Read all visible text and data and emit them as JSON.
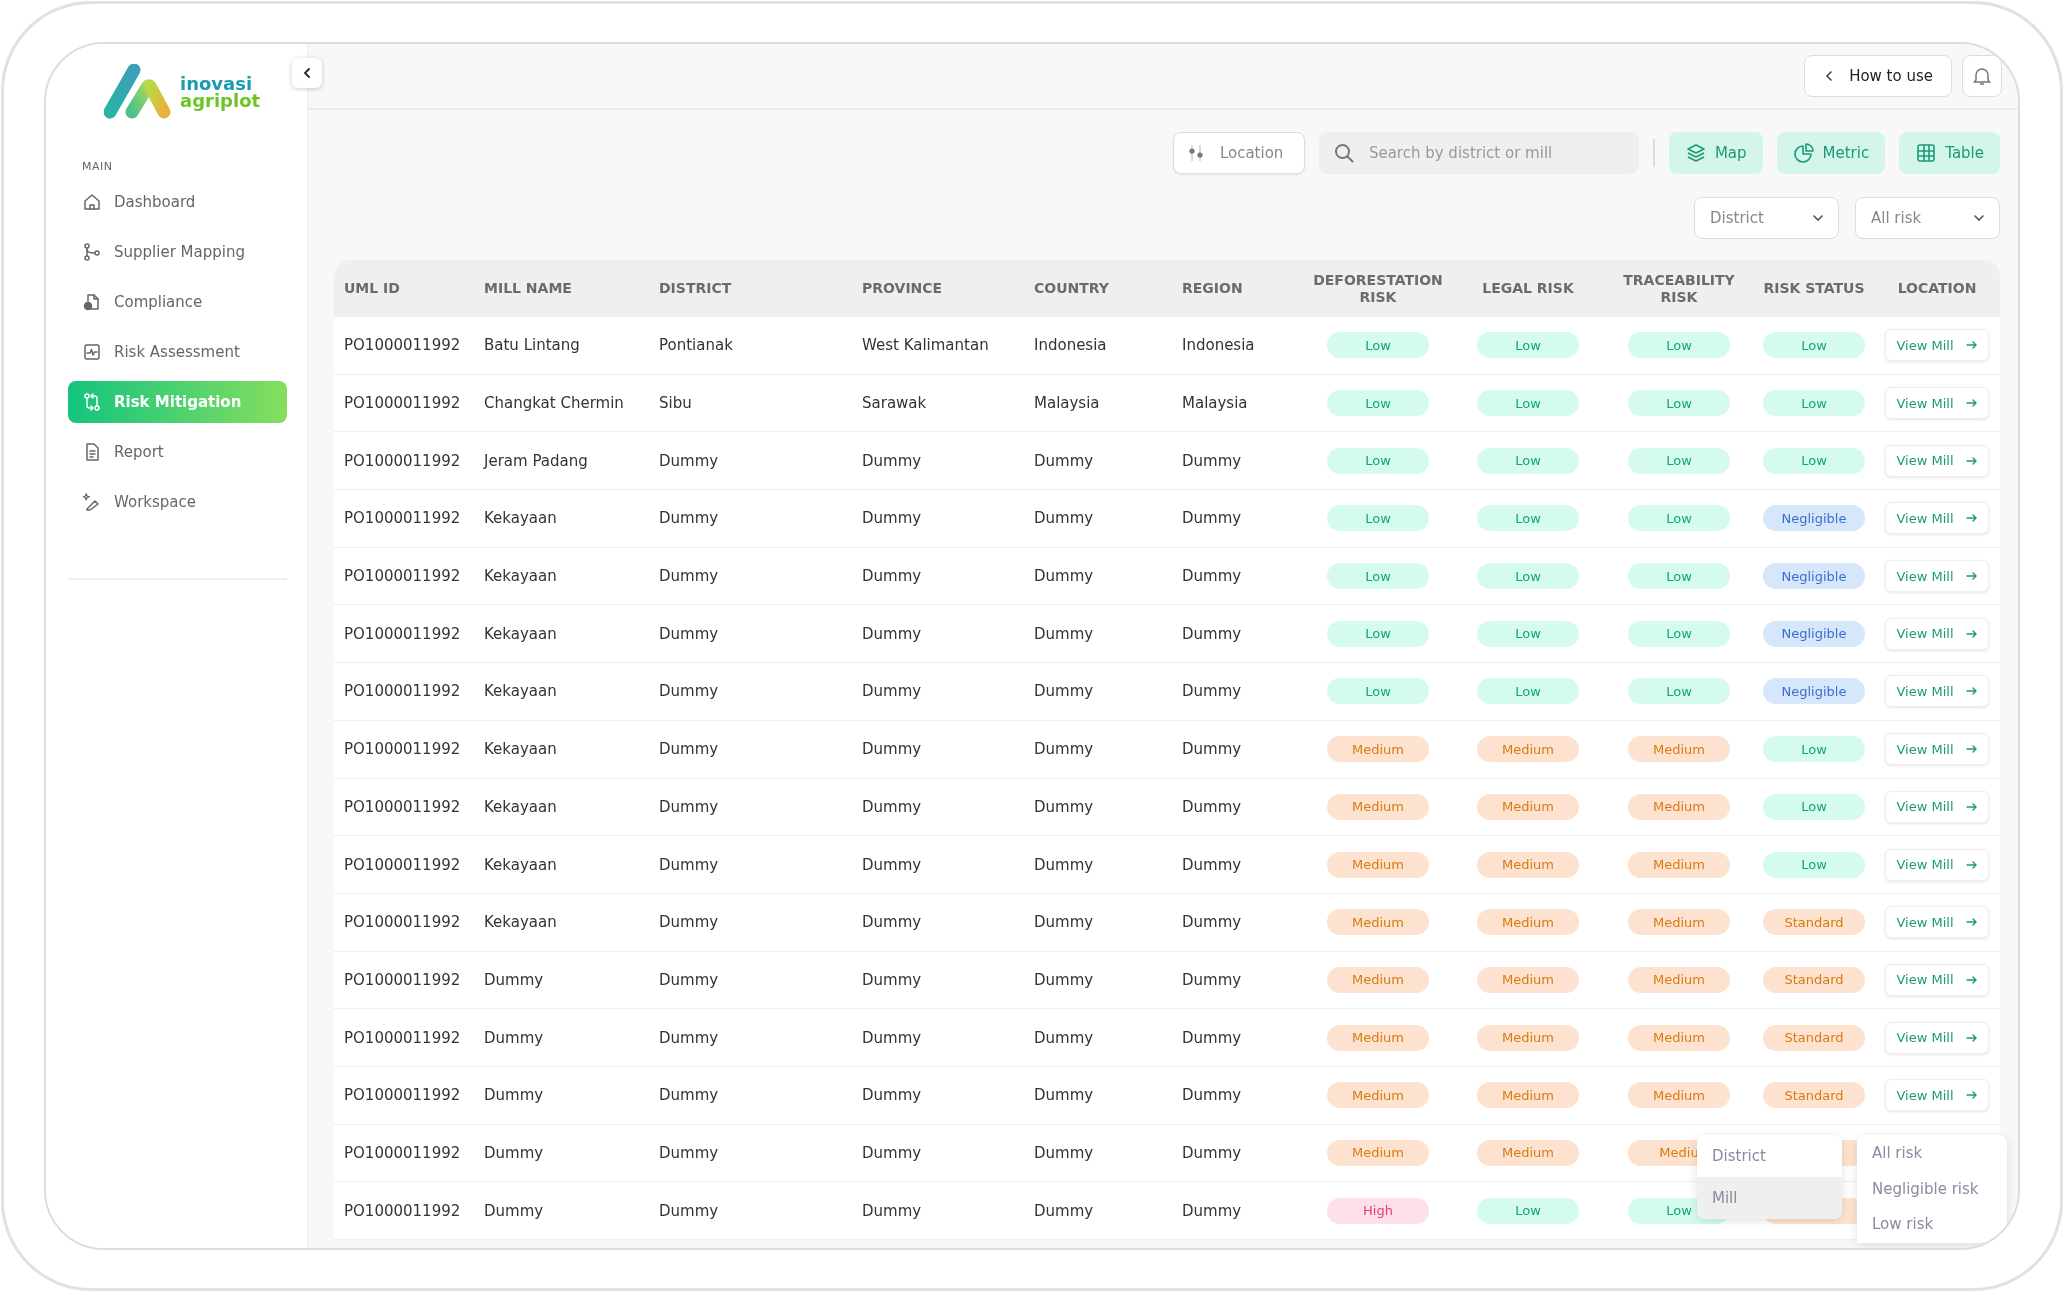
{
  "logo": {
    "line_1": "inovasi",
    "line_2": "agriplot"
  },
  "sidebar": {
    "section": "MAIN",
    "items": [
      {
        "label": "Dashboard",
        "selected": false
      },
      {
        "label": "Supplier Mapping",
        "selected": false
      },
      {
        "label": "Compliance",
        "selected": false
      },
      {
        "label": "Risk Assessment",
        "selected": false
      },
      {
        "label": "Risk Mitigation",
        "selected": true
      },
      {
        "label": "Report",
        "selected": false
      },
      {
        "label": "Workspace",
        "selected": false
      }
    ]
  },
  "topbar": {
    "help_button": "How to use"
  },
  "toolbar": {
    "location_button": "Location",
    "search": {
      "placeholder": "Search by district or mill"
    },
    "view_buttons": [
      {
        "label": "Map"
      },
      {
        "label": "Metric"
      },
      {
        "label": "Table"
      }
    ],
    "filters": [
      {
        "value": "District"
      },
      {
        "value": "All risk"
      }
    ]
  },
  "table": {
    "columns": [
      "UML ID",
      "MILL NAME",
      "DISTRICT",
      "PROVINCE",
      "COUNTRY",
      "REGION",
      "DEFORESTATION RISK",
      "LEGAL RISK",
      "TRACEABILITY RISK",
      "RISK STATUS",
      "LOCATION"
    ],
    "rows": [
      {
        "uml_id": "PO1000011992",
        "mill": "Batu Lintang",
        "district": "Pontianak",
        "province": "West Kalimantan",
        "country": "Indonesia",
        "region": "Indonesia",
        "risks": [
          {
            "label": "Low",
            "kind": "low"
          },
          {
            "label": "Low",
            "kind": "low"
          },
          {
            "label": "Low",
            "kind": "low"
          },
          {
            "label": "Low",
            "kind": "low"
          }
        ],
        "location": "View Mill"
      },
      {
        "uml_id": "PO1000011992",
        "mill": "Changkat Chermin",
        "district": "Sibu",
        "province": "Sarawak",
        "country": "Malaysia",
        "region": "Malaysia",
        "risks": [
          {
            "label": "Low",
            "kind": "low"
          },
          {
            "label": "Low",
            "kind": "low"
          },
          {
            "label": "Low",
            "kind": "low"
          },
          {
            "label": "Low",
            "kind": "low"
          }
        ],
        "location": "View Mill"
      },
      {
        "uml_id": "PO1000011992",
        "mill": "Jeram Padang",
        "district": "Dummy",
        "province": "Dummy",
        "country": "Dummy",
        "region": "Dummy",
        "risks": [
          {
            "label": "Low",
            "kind": "low"
          },
          {
            "label": "Low",
            "kind": "low"
          },
          {
            "label": "Low",
            "kind": "low"
          },
          {
            "label": "Low",
            "kind": "low"
          }
        ],
        "location": "View Mill"
      },
      {
        "uml_id": "PO1000011992",
        "mill": "Kekayaan",
        "district": "Dummy",
        "province": "Dummy",
        "country": "Dummy",
        "region": "Dummy",
        "risks": [
          {
            "label": "Low",
            "kind": "low"
          },
          {
            "label": "Low",
            "kind": "low"
          },
          {
            "label": "Low",
            "kind": "low"
          },
          {
            "label": "Negligible",
            "kind": "negligible"
          }
        ],
        "location": "View Mill"
      },
      {
        "uml_id": "PO1000011992",
        "mill": "Kekayaan",
        "district": "Dummy",
        "province": "Dummy",
        "country": "Dummy",
        "region": "Dummy",
        "risks": [
          {
            "label": "Low",
            "kind": "low"
          },
          {
            "label": "Low",
            "kind": "low"
          },
          {
            "label": "Low",
            "kind": "low"
          },
          {
            "label": "Negligible",
            "kind": "negligible"
          }
        ],
        "location": "View Mill"
      },
      {
        "uml_id": "PO1000011992",
        "mill": "Kekayaan",
        "district": "Dummy",
        "province": "Dummy",
        "country": "Dummy",
        "region": "Dummy",
        "risks": [
          {
            "label": "Low",
            "kind": "low"
          },
          {
            "label": "Low",
            "kind": "low"
          },
          {
            "label": "Low",
            "kind": "low"
          },
          {
            "label": "Negligible",
            "kind": "negligible"
          }
        ],
        "location": "View Mill"
      },
      {
        "uml_id": "PO1000011992",
        "mill": "Kekayaan",
        "district": "Dummy",
        "province": "Dummy",
        "country": "Dummy",
        "region": "Dummy",
        "risks": [
          {
            "label": "Low",
            "kind": "low"
          },
          {
            "label": "Low",
            "kind": "low"
          },
          {
            "label": "Low",
            "kind": "low"
          },
          {
            "label": "Negligible",
            "kind": "negligible"
          }
        ],
        "location": "View Mill"
      },
      {
        "uml_id": "PO1000011992",
        "mill": "Kekayaan",
        "district": "Dummy",
        "province": "Dummy",
        "country": "Dummy",
        "region": "Dummy",
        "risks": [
          {
            "label": "Medium",
            "kind": "medium"
          },
          {
            "label": "Medium",
            "kind": "medium"
          },
          {
            "label": "Medium",
            "kind": "medium"
          },
          {
            "label": "Low",
            "kind": "low"
          }
        ],
        "location": "View Mill"
      },
      {
        "uml_id": "PO1000011992",
        "mill": "Kekayaan",
        "district": "Dummy",
        "province": "Dummy",
        "country": "Dummy",
        "region": "Dummy",
        "risks": [
          {
            "label": "Medium",
            "kind": "medium"
          },
          {
            "label": "Medium",
            "kind": "medium"
          },
          {
            "label": "Medium",
            "kind": "medium"
          },
          {
            "label": "Low",
            "kind": "low"
          }
        ],
        "location": "View Mill"
      },
      {
        "uml_id": "PO1000011992",
        "mill": "Kekayaan",
        "district": "Dummy",
        "province": "Dummy",
        "country": "Dummy",
        "region": "Dummy",
        "risks": [
          {
            "label": "Medium",
            "kind": "medium"
          },
          {
            "label": "Medium",
            "kind": "medium"
          },
          {
            "label": "Medium",
            "kind": "medium"
          },
          {
            "label": "Low",
            "kind": "low"
          }
        ],
        "location": "View Mill"
      },
      {
        "uml_id": "PO1000011992",
        "mill": "Kekayaan",
        "district": "Dummy",
        "province": "Dummy",
        "country": "Dummy",
        "region": "Dummy",
        "risks": [
          {
            "label": "Medium",
            "kind": "medium"
          },
          {
            "label": "Medium",
            "kind": "medium"
          },
          {
            "label": "Medium",
            "kind": "medium"
          },
          {
            "label": "Standard",
            "kind": "standard"
          }
        ],
        "location": "View Mill"
      },
      {
        "uml_id": "PO1000011992",
        "mill": "Dummy",
        "district": "Dummy",
        "province": "Dummy",
        "country": "Dummy",
        "region": "Dummy",
        "risks": [
          {
            "label": "Medium",
            "kind": "medium"
          },
          {
            "label": "Medium",
            "kind": "medium"
          },
          {
            "label": "Medium",
            "kind": "medium"
          },
          {
            "label": "Standard",
            "kind": "standard"
          }
        ],
        "location": "View Mill"
      },
      {
        "uml_id": "PO1000011992",
        "mill": "Dummy",
        "district": "Dummy",
        "province": "Dummy",
        "country": "Dummy",
        "region": "Dummy",
        "risks": [
          {
            "label": "Medium",
            "kind": "medium"
          },
          {
            "label": "Medium",
            "kind": "medium"
          },
          {
            "label": "Medium",
            "kind": "medium"
          },
          {
            "label": "Standard",
            "kind": "standard"
          }
        ],
        "location": "View Mill"
      },
      {
        "uml_id": "PO1000011992",
        "mill": "Dummy",
        "district": "Dummy",
        "province": "Dummy",
        "country": "Dummy",
        "region": "Dummy",
        "risks": [
          {
            "label": "Medium",
            "kind": "medium"
          },
          {
            "label": "Medium",
            "kind": "medium"
          },
          {
            "label": "Medium",
            "kind": "medium"
          },
          {
            "label": "Standard",
            "kind": "standard"
          }
        ],
        "location": "View Mill"
      },
      {
        "uml_id": "PO1000011992",
        "mill": "Dummy",
        "district": "Dummy",
        "province": "Dummy",
        "country": "Dummy",
        "region": "Dummy",
        "risks": [
          {
            "label": "Medium",
            "kind": "medium"
          },
          {
            "label": "Medium",
            "kind": "medium"
          },
          {
            "label": "Mediu",
            "kind": "medium"
          },
          {
            "kind": "standard"
          }
        ]
      },
      {
        "uml_id": "PO1000011992",
        "mill": "Dummy",
        "district": "Dummy",
        "province": "Dummy",
        "country": "Dummy",
        "region": "Dummy",
        "risks": [
          {
            "label": "High",
            "kind": "high"
          },
          {
            "label": "Low",
            "kind": "low"
          },
          {
            "label": "Low",
            "kind": "low"
          },
          {
            "kind": "standard"
          }
        ]
      }
    ]
  },
  "menus": [
    {
      "items": [
        {
          "label": "District",
          "selected": false
        },
        {
          "label": "Mill",
          "selected": true
        }
      ]
    },
    {
      "items": [
        {
          "label": "All risk",
          "selected": false
        },
        {
          "label": "Negligible risk",
          "selected": false
        },
        {
          "label": "Low risk",
          "selected": false
        }
      ]
    }
  ]
}
